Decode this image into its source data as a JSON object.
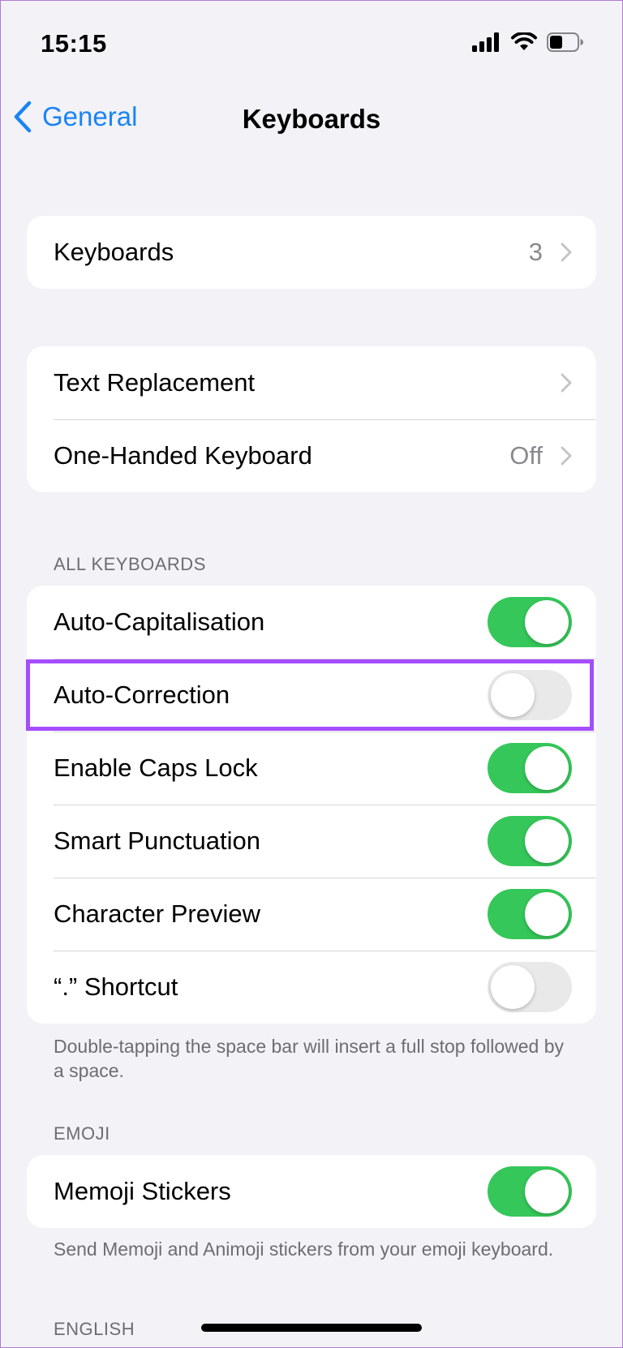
{
  "status_bar": {
    "time": "15:15",
    "icons": [
      "signal-icon",
      "wifi-icon",
      "battery-icon"
    ]
  },
  "nav": {
    "back_label": "General",
    "title": "Keyboards"
  },
  "groups": {
    "keyboards": {
      "label": "Keyboards",
      "value": "3"
    },
    "text": {
      "text_replacement": "Text Replacement",
      "one_handed_label": "One-Handed Keyboard",
      "one_handed_value": "Off"
    },
    "all_keyboards": {
      "header": "ALL KEYBOARDS",
      "items": [
        {
          "label": "Auto-Capitalisation",
          "on": true
        },
        {
          "label": "Auto-Correction",
          "on": false
        },
        {
          "label": "Enable Caps Lock",
          "on": true
        },
        {
          "label": "Smart Punctuation",
          "on": true
        },
        {
          "label": "Character Preview",
          "on": true
        },
        {
          "label": "“.” Shortcut",
          "on": false
        }
      ],
      "footer": "Double-tapping the space bar will insert a full stop followed by a space."
    },
    "emoji": {
      "header": "EMOJI",
      "memoji_label": "Memoji Stickers",
      "memoji_on": true,
      "footer": "Send Memoji and Animoji stickers from your emoji keyboard."
    },
    "english": {
      "header": "ENGLISH"
    }
  },
  "colors": {
    "accent": "#1a84f5",
    "toggle_on": "#35c759",
    "toggle_off": "#e9e9ea",
    "highlight": "#a64dff"
  }
}
